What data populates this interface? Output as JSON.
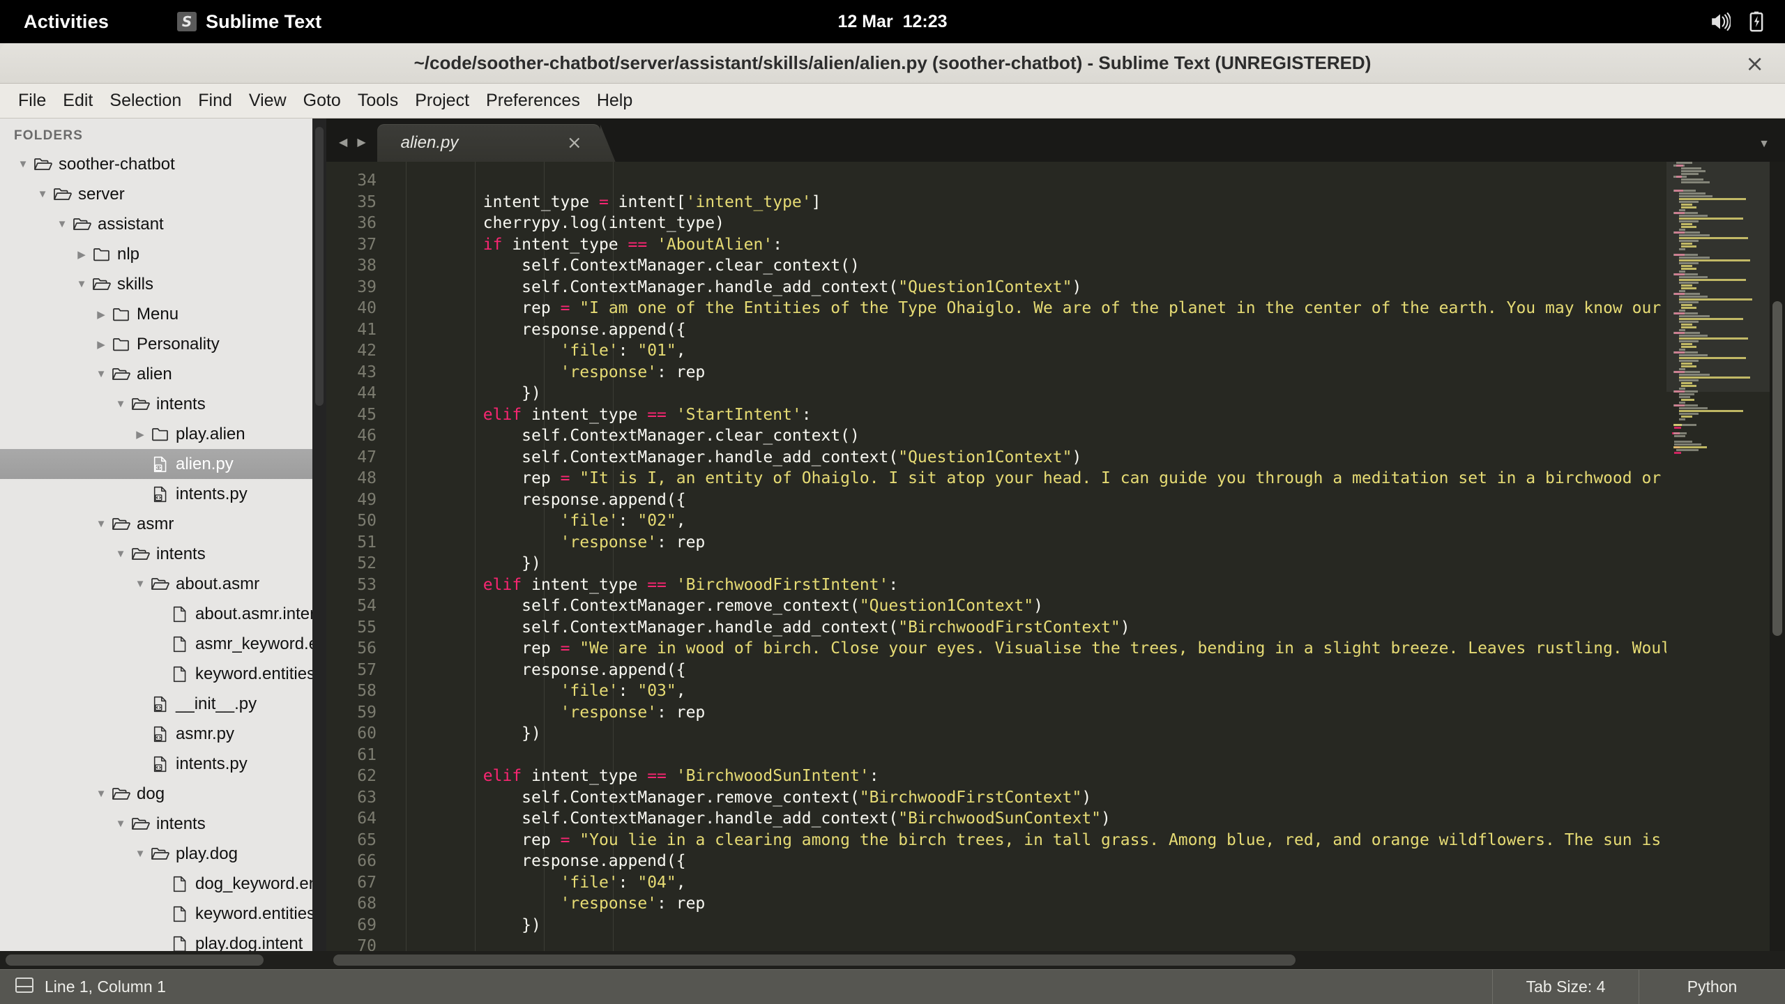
{
  "gnome": {
    "activities": "Activities",
    "app_name": "Sublime Text",
    "app_logo_glyph": "S",
    "clock": "12 Mar  12:23",
    "tray_icons": [
      "volume-icon",
      "battery-charging-icon"
    ]
  },
  "window": {
    "title": "~/code/soother-chatbot/server/assistant/skills/alien/alien.py (soother-chatbot) - Sublime Text (UNREGISTERED)",
    "close_glyph": "×"
  },
  "menubar": {
    "items": [
      "File",
      "Edit",
      "Selection",
      "Find",
      "View",
      "Goto",
      "Tools",
      "Project",
      "Preferences",
      "Help"
    ]
  },
  "sidebar": {
    "header": "FOLDERS",
    "tree": [
      {
        "label": "soother-chatbot",
        "depth": 0,
        "type": "folder-open",
        "state": "expanded",
        "selected": false
      },
      {
        "label": "server",
        "depth": 1,
        "type": "folder-open",
        "state": "expanded",
        "selected": false
      },
      {
        "label": "assistant",
        "depth": 2,
        "type": "folder-open",
        "state": "expanded",
        "selected": false
      },
      {
        "label": "nlp",
        "depth": 3,
        "type": "folder",
        "state": "collapsed",
        "selected": false
      },
      {
        "label": "skills",
        "depth": 3,
        "type": "folder-open",
        "state": "expanded",
        "selected": false
      },
      {
        "label": "Menu",
        "depth": 4,
        "type": "folder",
        "state": "collapsed",
        "selected": false
      },
      {
        "label": "Personality",
        "depth": 4,
        "type": "folder",
        "state": "collapsed",
        "selected": false
      },
      {
        "label": "alien",
        "depth": 4,
        "type": "folder-open",
        "state": "expanded",
        "selected": false
      },
      {
        "label": "intents",
        "depth": 5,
        "type": "folder-open",
        "state": "expanded",
        "selected": false
      },
      {
        "label": "play.alien",
        "depth": 6,
        "type": "folder",
        "state": "collapsed",
        "selected": false
      },
      {
        "label": "alien.py",
        "depth": 6,
        "type": "file-code",
        "state": "none",
        "selected": true
      },
      {
        "label": "intents.py",
        "depth": 6,
        "type": "file-code",
        "state": "none",
        "selected": false
      },
      {
        "label": "asmr",
        "depth": 4,
        "type": "folder-open",
        "state": "expanded",
        "selected": false
      },
      {
        "label": "intents",
        "depth": 5,
        "type": "folder-open",
        "state": "expanded",
        "selected": false
      },
      {
        "label": "about.asmr",
        "depth": 6,
        "type": "folder-open",
        "state": "expanded",
        "selected": false
      },
      {
        "label": "about.asmr.intent",
        "depth": 7,
        "type": "file",
        "state": "none",
        "selected": false
      },
      {
        "label": "asmr_keyword.entities",
        "depth": 7,
        "type": "file",
        "state": "none",
        "selected": false
      },
      {
        "label": "keyword.entities",
        "depth": 7,
        "type": "file",
        "state": "none",
        "selected": false
      },
      {
        "label": "__init__.py",
        "depth": 6,
        "type": "file-code",
        "state": "none",
        "selected": false
      },
      {
        "label": "asmr.py",
        "depth": 6,
        "type": "file-code",
        "state": "none",
        "selected": false
      },
      {
        "label": "intents.py",
        "depth": 6,
        "type": "file-code",
        "state": "none",
        "selected": false
      },
      {
        "label": "dog",
        "depth": 4,
        "type": "folder-open",
        "state": "expanded",
        "selected": false
      },
      {
        "label": "intents",
        "depth": 5,
        "type": "folder-open",
        "state": "expanded",
        "selected": false
      },
      {
        "label": "play.dog",
        "depth": 6,
        "type": "folder-open",
        "state": "expanded",
        "selected": false
      },
      {
        "label": "dog_keyword.entities",
        "depth": 7,
        "type": "file",
        "state": "none",
        "selected": false
      },
      {
        "label": "keyword.entities",
        "depth": 7,
        "type": "file",
        "state": "none",
        "selected": false
      },
      {
        "label": "play.dog.intent",
        "depth": 7,
        "type": "file",
        "state": "none",
        "selected": false
      }
    ]
  },
  "tabbar": {
    "prev_glyph": "◀",
    "next_glyph": "▶",
    "tab_label": "alien.py",
    "close_glyph": "×",
    "menu_glyph": "▼"
  },
  "editor": {
    "first_line": 34,
    "lines": [
      {
        "n": 34,
        "tokens": []
      },
      {
        "n": 35,
        "tokens": [
          {
            "t": "        intent_type ",
            "c": "pln"
          },
          {
            "t": "=",
            "c": "op"
          },
          {
            "t": " intent[",
            "c": "pln"
          },
          {
            "t": "'intent_type'",
            "c": "str"
          },
          {
            "t": "]",
            "c": "pln"
          }
        ]
      },
      {
        "n": 36,
        "tokens": [
          {
            "t": "        cherrypy.log(intent_type)",
            "c": "pln"
          }
        ]
      },
      {
        "n": 37,
        "tokens": [
          {
            "t": "        ",
            "c": "pln"
          },
          {
            "t": "if",
            "c": "kw"
          },
          {
            "t": " intent_type ",
            "c": "pln"
          },
          {
            "t": "==",
            "c": "op"
          },
          {
            "t": " ",
            "c": "pln"
          },
          {
            "t": "'AboutAlien'",
            "c": "str"
          },
          {
            "t": ":",
            "c": "pln"
          }
        ]
      },
      {
        "n": 38,
        "tokens": [
          {
            "t": "            self.ContextManager.clear_context()",
            "c": "pln"
          }
        ]
      },
      {
        "n": 39,
        "tokens": [
          {
            "t": "            self.ContextManager.handle_add_context(",
            "c": "pln"
          },
          {
            "t": "\"Question1Context\"",
            "c": "str"
          },
          {
            "t": ")",
            "c": "pln"
          }
        ]
      },
      {
        "n": 40,
        "tokens": [
          {
            "t": "            rep ",
            "c": "pln"
          },
          {
            "t": "=",
            "c": "op"
          },
          {
            "t": " ",
            "c": "pln"
          },
          {
            "t": "\"I am one of the Entities of the Type Ohaiglo. We are of the planet in the center of the earth. You may know our ancestors",
            "c": "str"
          }
        ]
      },
      {
        "n": 41,
        "tokens": [
          {
            "t": "            response.append({",
            "c": "pln"
          }
        ]
      },
      {
        "n": 42,
        "tokens": [
          {
            "t": "                ",
            "c": "pln"
          },
          {
            "t": "'file'",
            "c": "str"
          },
          {
            "t": ": ",
            "c": "pln"
          },
          {
            "t": "\"01\"",
            "c": "str"
          },
          {
            "t": ",",
            "c": "pln"
          }
        ]
      },
      {
        "n": 43,
        "tokens": [
          {
            "t": "                ",
            "c": "pln"
          },
          {
            "t": "'response'",
            "c": "str"
          },
          {
            "t": ": rep",
            "c": "pln"
          }
        ]
      },
      {
        "n": 44,
        "tokens": [
          {
            "t": "            })",
            "c": "pln"
          }
        ]
      },
      {
        "n": 45,
        "tokens": [
          {
            "t": "        ",
            "c": "pln"
          },
          {
            "t": "elif",
            "c": "kw"
          },
          {
            "t": " intent_type ",
            "c": "pln"
          },
          {
            "t": "==",
            "c": "op"
          },
          {
            "t": " ",
            "c": "pln"
          },
          {
            "t": "'StartIntent'",
            "c": "str"
          },
          {
            "t": ":",
            "c": "pln"
          }
        ]
      },
      {
        "n": 46,
        "tokens": [
          {
            "t": "            self.ContextManager.clear_context()",
            "c": "pln"
          }
        ]
      },
      {
        "n": 47,
        "tokens": [
          {
            "t": "            self.ContextManager.handle_add_context(",
            "c": "pln"
          },
          {
            "t": "\"Question1Context\"",
            "c": "str"
          },
          {
            "t": ")",
            "c": "pln"
          }
        ]
      },
      {
        "n": 48,
        "tokens": [
          {
            "t": "            rep ",
            "c": "pln"
          },
          {
            "t": "=",
            "c": "op"
          },
          {
            "t": " ",
            "c": "pln"
          },
          {
            "t": "\"It is I, an entity of Ohaiglo. I sit atop your head. I can guide you through a meditation set in a birchwood or in my home",
            "c": "str"
          }
        ]
      },
      {
        "n": 49,
        "tokens": [
          {
            "t": "            response.append({",
            "c": "pln"
          }
        ]
      },
      {
        "n": 50,
        "tokens": [
          {
            "t": "                ",
            "c": "pln"
          },
          {
            "t": "'file'",
            "c": "str"
          },
          {
            "t": ": ",
            "c": "pln"
          },
          {
            "t": "\"02\"",
            "c": "str"
          },
          {
            "t": ",",
            "c": "pln"
          }
        ]
      },
      {
        "n": 51,
        "tokens": [
          {
            "t": "                ",
            "c": "pln"
          },
          {
            "t": "'response'",
            "c": "str"
          },
          {
            "t": ": rep",
            "c": "pln"
          }
        ]
      },
      {
        "n": 52,
        "tokens": [
          {
            "t": "            })",
            "c": "pln"
          }
        ]
      },
      {
        "n": 53,
        "tokens": [
          {
            "t": "        ",
            "c": "pln"
          },
          {
            "t": "elif",
            "c": "kw"
          },
          {
            "t": " intent_type ",
            "c": "pln"
          },
          {
            "t": "==",
            "c": "op"
          },
          {
            "t": " ",
            "c": "pln"
          },
          {
            "t": "'BirchwoodFirstIntent'",
            "c": "str"
          },
          {
            "t": ":",
            "c": "pln"
          }
        ]
      },
      {
        "n": 54,
        "tokens": [
          {
            "t": "            self.ContextManager.remove_context(",
            "c": "pln"
          },
          {
            "t": "\"Question1Context\"",
            "c": "str"
          },
          {
            "t": ")",
            "c": "pln"
          }
        ]
      },
      {
        "n": 55,
        "tokens": [
          {
            "t": "            self.ContextManager.handle_add_context(",
            "c": "pln"
          },
          {
            "t": "\"BirchwoodFirstContext\"",
            "c": "str"
          },
          {
            "t": ")",
            "c": "pln"
          }
        ]
      },
      {
        "n": 56,
        "tokens": [
          {
            "t": "            rep ",
            "c": "pln"
          },
          {
            "t": "=",
            "c": "op"
          },
          {
            "t": " ",
            "c": "pln"
          },
          {
            "t": "\"We are in wood of birch. Close your eyes. Visualise the trees, bending in a slight breeze. Leaves rustling. Would you like",
            "c": "str"
          }
        ]
      },
      {
        "n": 57,
        "tokens": [
          {
            "t": "            response.append({",
            "c": "pln"
          }
        ]
      },
      {
        "n": 58,
        "tokens": [
          {
            "t": "                ",
            "c": "pln"
          },
          {
            "t": "'file'",
            "c": "str"
          },
          {
            "t": ": ",
            "c": "pln"
          },
          {
            "t": "\"03\"",
            "c": "str"
          },
          {
            "t": ",",
            "c": "pln"
          }
        ]
      },
      {
        "n": 59,
        "tokens": [
          {
            "t": "                ",
            "c": "pln"
          },
          {
            "t": "'response'",
            "c": "str"
          },
          {
            "t": ": rep",
            "c": "pln"
          }
        ]
      },
      {
        "n": 60,
        "tokens": [
          {
            "t": "            })",
            "c": "pln"
          }
        ]
      },
      {
        "n": 61,
        "tokens": []
      },
      {
        "n": 62,
        "tokens": [
          {
            "t": "        ",
            "c": "pln"
          },
          {
            "t": "elif",
            "c": "kw"
          },
          {
            "t": " intent_type ",
            "c": "pln"
          },
          {
            "t": "==",
            "c": "op"
          },
          {
            "t": " ",
            "c": "pln"
          },
          {
            "t": "'BirchwoodSunIntent'",
            "c": "str"
          },
          {
            "t": ":",
            "c": "pln"
          }
        ]
      },
      {
        "n": 63,
        "tokens": [
          {
            "t": "            self.ContextManager.remove_context(",
            "c": "pln"
          },
          {
            "t": "\"BirchwoodFirstContext\"",
            "c": "str"
          },
          {
            "t": ")",
            "c": "pln"
          }
        ]
      },
      {
        "n": 64,
        "tokens": [
          {
            "t": "            self.ContextManager.handle_add_context(",
            "c": "pln"
          },
          {
            "t": "\"BirchwoodSunContext\"",
            "c": "str"
          },
          {
            "t": ")",
            "c": "pln"
          }
        ]
      },
      {
        "n": 65,
        "tokens": [
          {
            "t": "            rep ",
            "c": "pln"
          },
          {
            "t": "=",
            "c": "op"
          },
          {
            "t": " ",
            "c": "pln"
          },
          {
            "t": "\"You lie in a clearing among the birch trees, in tall grass. Among blue, red, and orange wildflowers. The sun is strong on",
            "c": "str"
          }
        ]
      },
      {
        "n": 66,
        "tokens": [
          {
            "t": "            response.append({",
            "c": "pln"
          }
        ]
      },
      {
        "n": 67,
        "tokens": [
          {
            "t": "                ",
            "c": "pln"
          },
          {
            "t": "'file'",
            "c": "str"
          },
          {
            "t": ": ",
            "c": "pln"
          },
          {
            "t": "\"04\"",
            "c": "str"
          },
          {
            "t": ",",
            "c": "pln"
          }
        ]
      },
      {
        "n": 68,
        "tokens": [
          {
            "t": "                ",
            "c": "pln"
          },
          {
            "t": "'response'",
            "c": "str"
          },
          {
            "t": ": rep",
            "c": "pln"
          }
        ]
      },
      {
        "n": 69,
        "tokens": [
          {
            "t": "            })",
            "c": "pln"
          }
        ]
      },
      {
        "n": 70,
        "tokens": []
      }
    ]
  },
  "statusbar": {
    "position": "Line 1, Column 1",
    "tab_size": "Tab Size: 4",
    "syntax": "Python"
  },
  "colors": {
    "editor_bg": "#272822",
    "keyword": "#f92672",
    "string": "#e6db74",
    "plain": "#f8f8f2",
    "gutter": "#7c7c70",
    "sidebar_bg": "#e7e6e4",
    "selection": "#a0a0a0",
    "statusbar_bg": "#565651"
  }
}
